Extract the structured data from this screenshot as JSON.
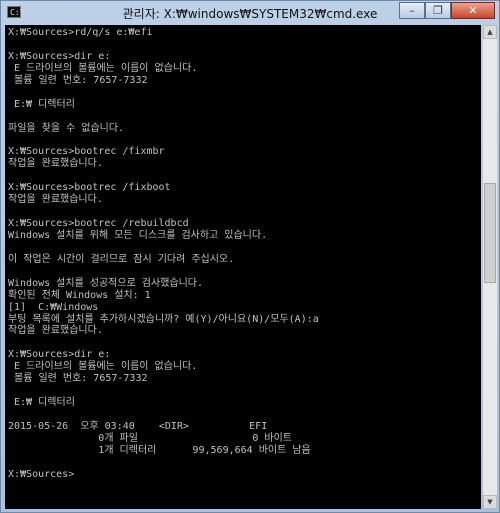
{
  "window": {
    "title": "관리자: X:₩windows₩SYSTEM32₩cmd.exe",
    "icon_text": "C:\\",
    "minimize_glyph": "–",
    "maximize_glyph": "❐",
    "close_glyph": "✕"
  },
  "scrollbar": {
    "up_glyph": "▲",
    "down_glyph": "▼"
  },
  "console": {
    "lines": [
      "X:₩Sources>rd/q/s e:₩efi",
      "",
      "X:₩Sources>dir e:",
      " E 드라이브의 볼륨에는 이름이 없습니다.",
      " 볼륨 일련 번호: 7657-7332",
      "",
      " E:₩ 디렉터리",
      "",
      "파일을 찾을 수 없습니다.",
      "",
      "X:₩Sources>bootrec /fixmbr",
      "작업을 완료했습니다.",
      "",
      "X:₩Sources>bootrec /fixboot",
      "작업을 완료했습니다.",
      "",
      "X:₩Sources>bootrec /rebuildbcd",
      "Windows 설치를 위해 모든 디스크를 검사하고 있습니다.",
      "",
      "이 작업은 시간이 걸리므로 잠시 기다려 주십시오.",
      "",
      "Windows 설치를 성공적으로 검사했습니다.",
      "확인된 전체 Windows 설치: 1",
      "[1]  C:₩Windows",
      "부팅 목록에 설치를 추가하시겠습니까? 예(Y)/아니요(N)/모두(A):a",
      "작업을 완료했습니다.",
      "",
      "X:₩Sources>dir e:",
      " E 드라이브의 볼륨에는 이름이 없습니다.",
      " 볼륨 일련 번호: 7657-7332",
      "",
      " E:₩ 디렉터리",
      "",
      "2015-05-26  오후 03:40    <DIR>          EFI",
      "               0개 파일                   0 바이트",
      "               1개 디렉터리      99,569,664 바이트 남음",
      "",
      "X:₩Sources>"
    ]
  }
}
